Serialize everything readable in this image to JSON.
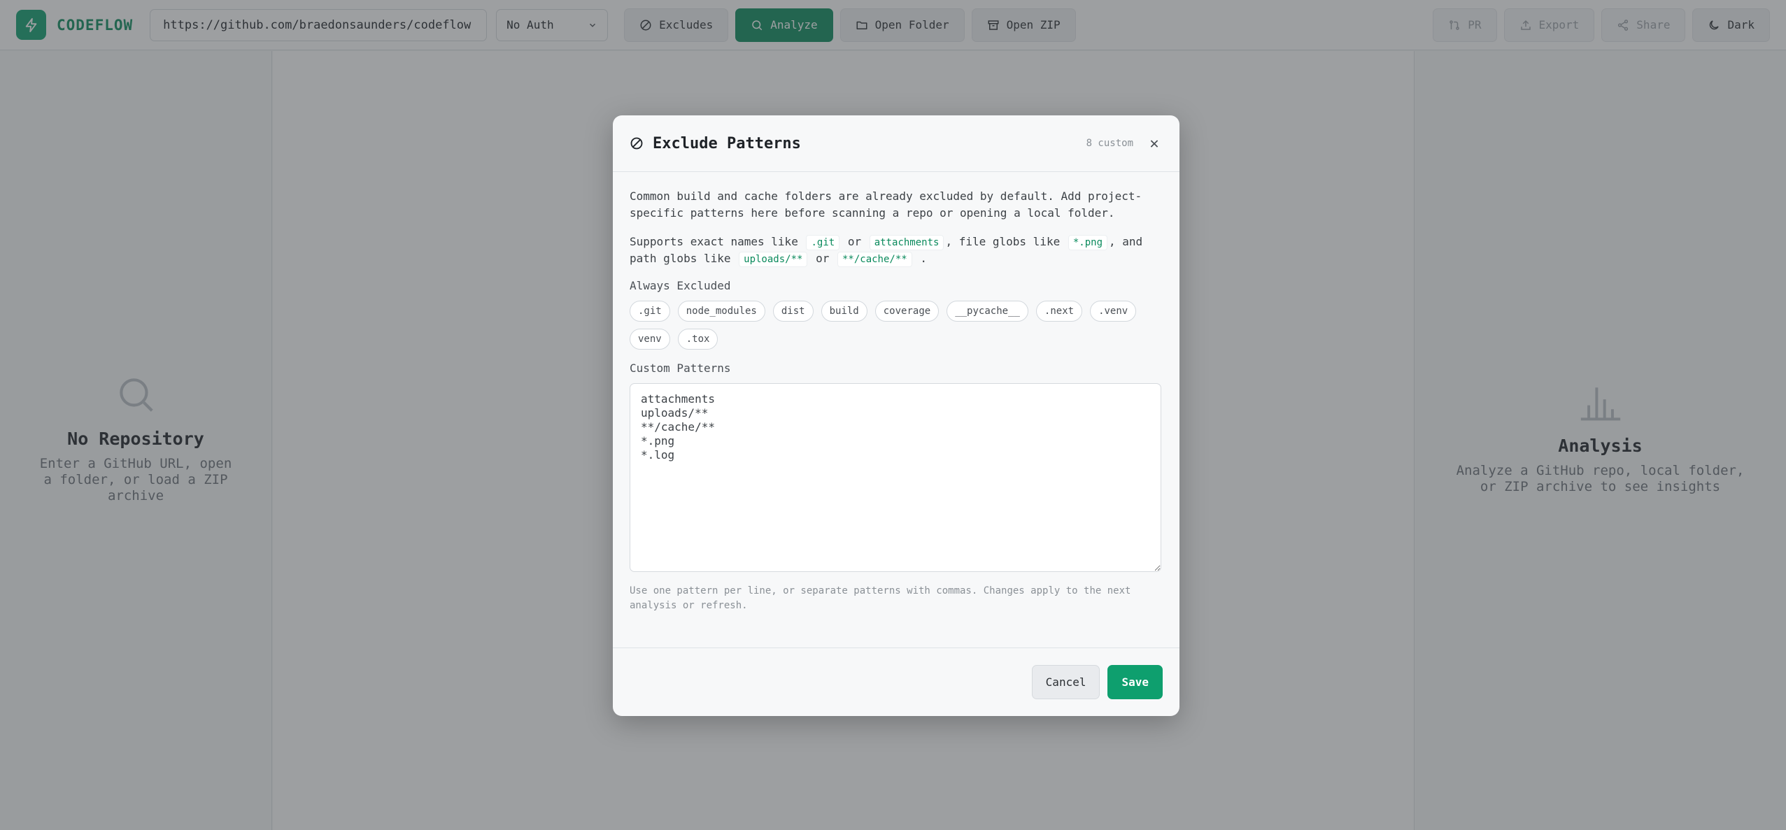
{
  "header": {
    "brand": "CODEFLOW",
    "url_value": "https://github.com/braedonsaunders/codeflow",
    "auth_selected": "No Auth",
    "buttons": {
      "excludes": "Excludes",
      "analyze": "Analyze",
      "open_folder": "Open Folder",
      "open_zip": "Open ZIP",
      "pr": "PR",
      "export": "Export",
      "share": "Share",
      "theme": "Dark"
    }
  },
  "left_panel": {
    "title": "No Repository",
    "description_lines": [
      "Enter a GitHub URL, open",
      "a folder, or load a ZIP",
      "archive"
    ]
  },
  "right_panel": {
    "title": "Analysis",
    "description_lines": [
      "Analyze a GitHub repo, local folder,",
      "or ZIP archive to see insights"
    ]
  },
  "modal": {
    "title": "Exclude Patterns",
    "custom_count": "8 custom",
    "close_glyph": "✕",
    "intro": "Common build and cache folders are already excluded by default. Add project-specific patterns here before scanning a repo or opening a local folder.",
    "supports": {
      "t1": "Supports exact names like",
      "c1": ".git",
      "t2": "or",
      "c2": "attachments",
      "t3": ", file globs like",
      "c3": "*.png",
      "t4": ", and path globs like",
      "c4": "uploads/**",
      "t5": "or",
      "c5": "**/cache/**",
      "t6": "."
    },
    "always_label": "Always Excluded",
    "always_chips": [
      ".git",
      "node_modules",
      "dist",
      "build",
      "coverage",
      "__pycache__",
      ".next",
      ".venv",
      "venv",
      ".tox"
    ],
    "custom_label": "Custom Patterns",
    "custom_patterns": "attachments\nuploads/**\n**/cache/**\n*.png\n*.log",
    "hint": "Use one pattern per line, or separate patterns with commas. Changes apply to the next analysis or refresh.",
    "cancel_label": "Cancel",
    "save_label": "Save"
  },
  "colors": {
    "accent": "#0a8a5c",
    "accent_bright": "#0e9f6e",
    "overlay": "rgba(60,64,67,0.5)"
  }
}
